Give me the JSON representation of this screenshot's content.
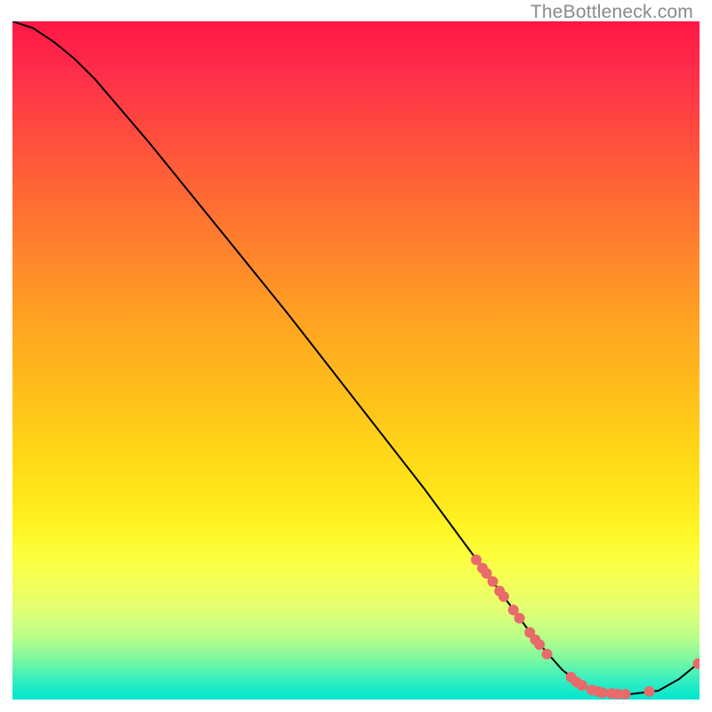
{
  "attribution": "TheBottleneck.com",
  "chart_data": {
    "type": "line",
    "title": "",
    "xlabel": "",
    "ylabel": "",
    "xlim": [
      0,
      100
    ],
    "ylim": [
      0,
      100
    ],
    "grid": false,
    "legend": false,
    "note": "Vertical axis is a bottleneck/mismatch percentage plotted against a horizontal component-performance axis; background gradient encodes severity (red high → green low). Tick labels and numeric axis values are not rendered in the image, so x/y here are read off as percentages of the plot area (0–100).",
    "curve": [
      {
        "x": 0.0,
        "y": 100.0
      },
      {
        "x": 3.0,
        "y": 99.0
      },
      {
        "x": 6.0,
        "y": 97.0
      },
      {
        "x": 9.0,
        "y": 94.5
      },
      {
        "x": 12.0,
        "y": 91.5
      },
      {
        "x": 20.0,
        "y": 82.0
      },
      {
        "x": 30.0,
        "y": 69.5
      },
      {
        "x": 40.0,
        "y": 57.0
      },
      {
        "x": 50.0,
        "y": 44.0
      },
      {
        "x": 60.0,
        "y": 31.0
      },
      {
        "x": 68.0,
        "y": 20.0
      },
      {
        "x": 72.0,
        "y": 14.5
      },
      {
        "x": 76.0,
        "y": 9.0
      },
      {
        "x": 80.0,
        "y": 4.4
      },
      {
        "x": 83.0,
        "y": 2.0
      },
      {
        "x": 86.0,
        "y": 1.0
      },
      {
        "x": 90.0,
        "y": 0.8
      },
      {
        "x": 94.0,
        "y": 1.3
      },
      {
        "x": 97.0,
        "y": 3.0
      },
      {
        "x": 100.0,
        "y": 5.5
      }
    ],
    "points": [
      {
        "x": 67.5,
        "y": 20.6
      },
      {
        "x": 68.4,
        "y": 19.4
      },
      {
        "x": 69.0,
        "y": 18.6
      },
      {
        "x": 69.9,
        "y": 17.4
      },
      {
        "x": 70.9,
        "y": 16.0
      },
      {
        "x": 71.5,
        "y": 15.2
      },
      {
        "x": 72.9,
        "y": 13.2
      },
      {
        "x": 73.8,
        "y": 12.0
      },
      {
        "x": 75.3,
        "y": 9.9
      },
      {
        "x": 76.1,
        "y": 8.8
      },
      {
        "x": 76.7,
        "y": 8.1
      },
      {
        "x": 77.8,
        "y": 6.7
      },
      {
        "x": 81.3,
        "y": 3.3
      },
      {
        "x": 82.1,
        "y": 2.6
      },
      {
        "x": 82.9,
        "y": 2.1
      },
      {
        "x": 84.3,
        "y": 1.4
      },
      {
        "x": 85.2,
        "y": 1.2
      },
      {
        "x": 85.9,
        "y": 1.0
      },
      {
        "x": 87.2,
        "y": 0.9
      },
      {
        "x": 88.1,
        "y": 0.8
      },
      {
        "x": 89.2,
        "y": 0.8
      },
      {
        "x": 92.7,
        "y": 1.2
      },
      {
        "x": 99.8,
        "y": 5.3
      }
    ],
    "point_radius": 6
  }
}
